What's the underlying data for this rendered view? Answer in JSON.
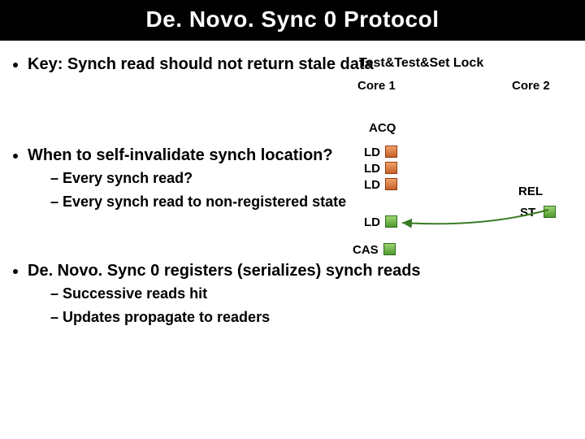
{
  "title": "De. Novo. Sync 0 Protocol",
  "bullets": {
    "key": "Key: Synch read should not return stale data",
    "when": "When to self-invalidate synch location?",
    "when_sub1": "Every synch read?",
    "when_sub2": "Every synch read to non-registered state",
    "reg": "De. Novo. Sync 0 registers (serializes) synch reads",
    "reg_sub1": "Successive reads hit",
    "reg_sub2": "Updates propagate to readers"
  },
  "diagram": {
    "tts": "Test&Test&Set Lock",
    "core1": "Core 1",
    "core2": "Core 2",
    "acq": "ACQ",
    "rel": "REL",
    "st": "ST",
    "ld": "LD",
    "cas": "CAS"
  }
}
